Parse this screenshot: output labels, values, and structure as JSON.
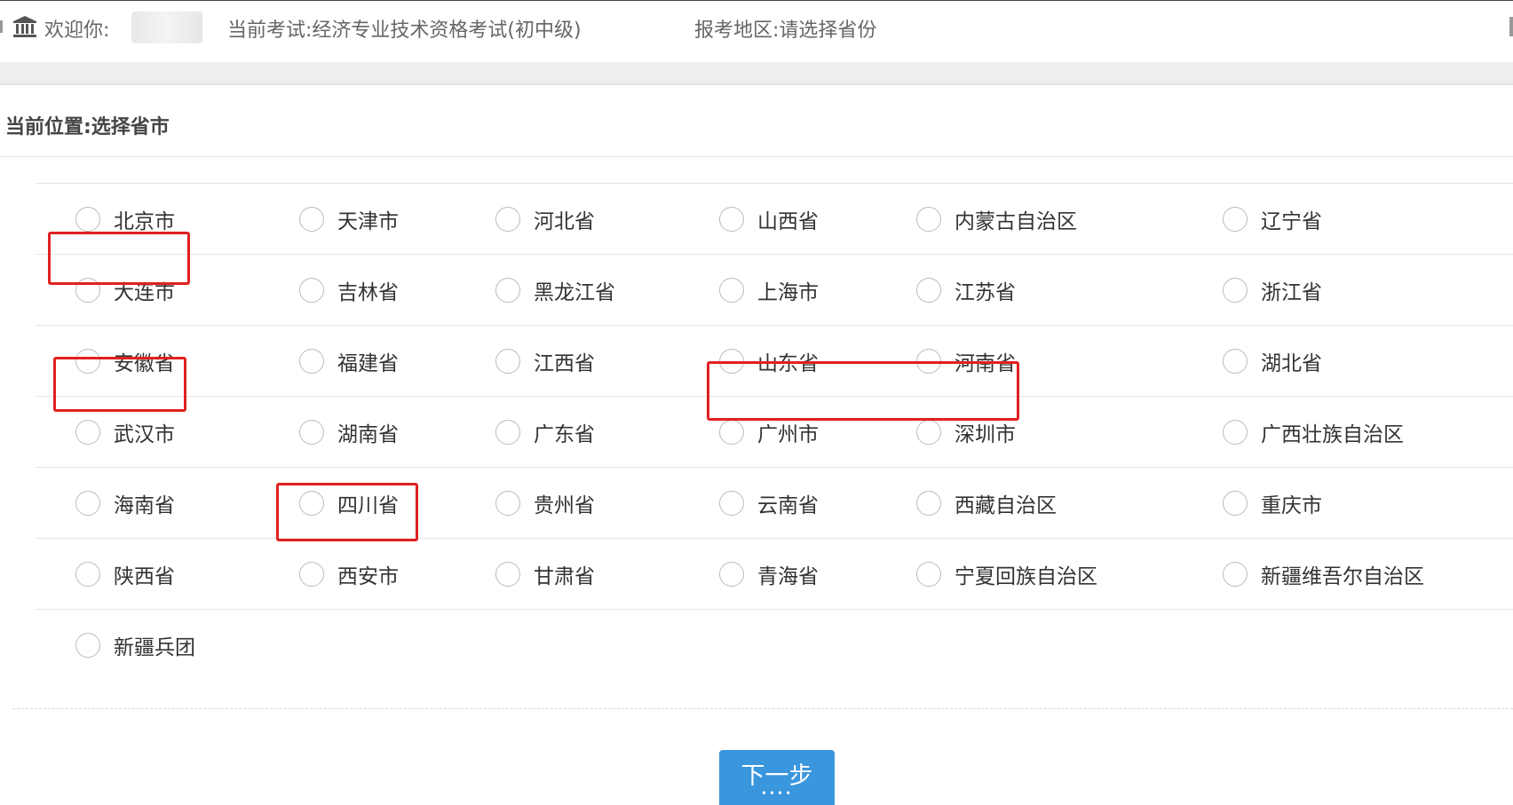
{
  "header": {
    "welcome_label": "欢迎你:",
    "username": "",
    "exam": "当前考试:经济专业技术资格考试(初中级)",
    "region": "报考地区:请选择省份",
    "icon": "bank-icon"
  },
  "breadcrumb": "当前位置:选择省市",
  "provinces": [
    [
      "北京市",
      "天津市",
      "河北省",
      "山西省",
      "内蒙古自治区",
      "辽宁省"
    ],
    [
      "大连市",
      "吉林省",
      "黑龙江省",
      "上海市",
      "江苏省",
      "浙江省"
    ],
    [
      "安徽省",
      "福建省",
      "江西省",
      "山东省",
      "河南省",
      "湖北省"
    ],
    [
      "武汉市",
      "湖南省",
      "广东省",
      "广州市",
      "深圳市",
      "广西壮族自治区"
    ],
    [
      "海南省",
      "四川省",
      "贵州省",
      "云南省",
      "西藏自治区",
      "重庆市"
    ],
    [
      "陕西省",
      "西安市",
      "甘肃省",
      "青海省",
      "宁夏回族自治区",
      "新疆维吾尔自治区"
    ],
    [
      "新疆兵团"
    ]
  ],
  "highlighted": [
    "大连市",
    "武汉市",
    "广州市",
    "深圳市",
    "西安市"
  ],
  "next_button": "下一步",
  "colors": {
    "highlight": "#e02020",
    "button": "#3a96dd"
  }
}
